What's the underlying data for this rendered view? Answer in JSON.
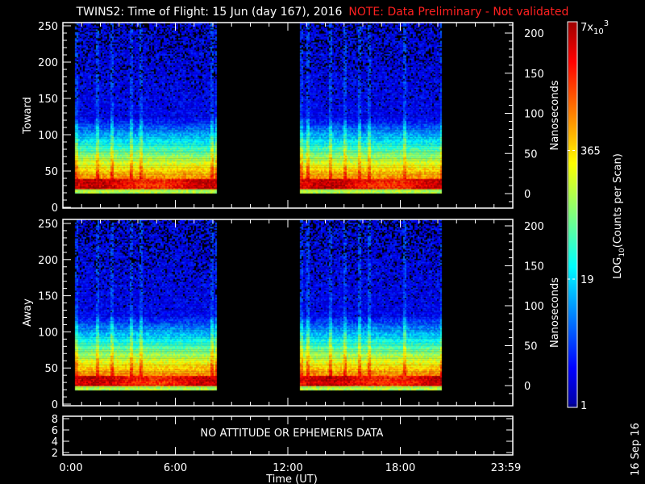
{
  "title": {
    "main": "TWINS2: Time of Flight: 15 Jun (day 167), 2016",
    "note": "NOTE: Data Preliminary - Not validated"
  },
  "chart_data": [
    {
      "type": "heatmap",
      "name": "Toward",
      "ylabel": "Toward",
      "y2label": "Nanoseconds",
      "ylim": [
        0,
        255
      ],
      "yticks": [
        0,
        50,
        100,
        150,
        200,
        250
      ],
      "y2ticks": [
        0,
        50,
        100,
        150,
        200
      ],
      "y2lim": [
        -17,
        215
      ]
    },
    {
      "type": "heatmap",
      "name": "Away",
      "ylabel": "Away",
      "y2label": "Nanoseconds",
      "ylim": [
        0,
        255
      ],
      "yticks": [
        0,
        50,
        100,
        150,
        200,
        250
      ],
      "y2ticks": [
        0,
        50,
        100,
        150,
        200
      ],
      "y2lim": [
        -17,
        215
      ]
    },
    {
      "type": "table",
      "name": "Attitude/Ephemeris",
      "message": "NO ATTITUDE OR EPHEMERIS DATA",
      "yticks": [
        2,
        4,
        6,
        8
      ]
    }
  ],
  "xaxis": {
    "label": "Time (UT)",
    "xlim_hours": [
      0,
      24
    ],
    "tick_labels": [
      "0:00",
      "6:00",
      "12:00",
      "18:00",
      "23:59"
    ],
    "tick_hours": [
      0,
      6,
      12,
      18,
      23.98
    ]
  },
  "data_intervals_hours": [
    [
      0.65,
      8.2
    ],
    [
      12.65,
      20.2
    ]
  ],
  "colorbar": {
    "label": "LOG10(Counts per Scan)",
    "label_base": "LOG",
    "label_sub": "10",
    "label_rest": "(Counts per Scan)",
    "min": 1,
    "max": 7000,
    "tick_labels": [
      "1",
      "19",
      "365"
    ],
    "tick_values": [
      1,
      19,
      365
    ],
    "max_label_base": "7x",
    "max_label_sub": "10",
    "max_label_sup": "3",
    "scale": "log"
  },
  "date_stamp": "16 Sep 16"
}
